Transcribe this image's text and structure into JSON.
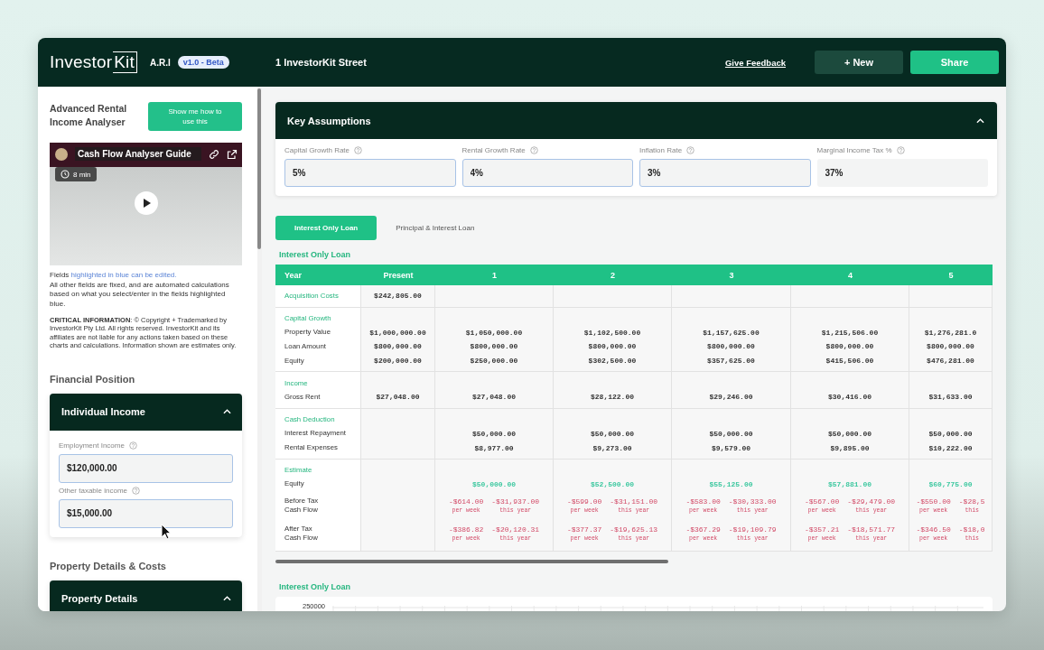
{
  "header": {
    "logo": {
      "word": "Investor",
      "boxed": "Kit"
    },
    "app_name": "A.R.I",
    "version_badge": "v1.0 - Beta",
    "property_address": "1 InvestorKit Street",
    "feedback_link": "Give Feedback",
    "buttons": [
      {
        "label": "+ New",
        "kind": "secondary"
      },
      {
        "label": "Share",
        "kind": "primary"
      }
    ]
  },
  "sidebar": {
    "title": "Advanced Rental Income Analyser",
    "help_button": "Show me how to use this",
    "video": {
      "title": "Cash Flow Analyser Guide",
      "duration": "8 min"
    },
    "fields_note": {
      "lead": "Fields",
      "highlight": "highlighted in blue can be edited.",
      "rest": "All other fields are fixed, and are automated calculations based on what you select/enter in the fields highlighted blue."
    },
    "critical_info": "**CRITICAL INFORMATION**: © Copyright + Trademarked by InvestorKit Pty Ltd. All rights reserved. InvestorKit and its affiliates are not liable for any actions taken based on these charts and calculations. Information shown are estimates only.",
    "sections": [
      {
        "heading": "Financial Position",
        "panel": {
          "title": "Individual Income",
          "expanded": true,
          "fields": [
            {
              "label": "Employment Income",
              "value": "$120,000.00",
              "editable": true
            },
            {
              "label": "Other taxable income",
              "value": "$15,000.00",
              "editable": true
            }
          ]
        }
      },
      {
        "heading": "Property Details & Costs",
        "panel": {
          "title": "Property Details",
          "expanded": true
        }
      }
    ]
  },
  "key_assumptions": {
    "title": "Key Assumptions",
    "expanded": true,
    "fields": [
      {
        "label": "Capital Growth Rate",
        "value": "5%",
        "editable": true
      },
      {
        "label": "Rental Growth Rate",
        "value": "4%",
        "editable": true
      },
      {
        "label": "Inflation Rate",
        "value": "3%",
        "editable": true
      },
      {
        "label": "Marginal Income Tax %",
        "value": "37%",
        "editable": false
      }
    ]
  },
  "loan_tabs": [
    {
      "label": "Interest Only Loan",
      "selected": true
    },
    {
      "label": "Principal & Interest Loan",
      "selected": false
    }
  ],
  "table": {
    "title": "Interest Only Loan",
    "columns": [
      "Year",
      "Present",
      "1",
      "2",
      "3",
      "4",
      "5"
    ],
    "sections": [
      {
        "title": "Acquisition Costs",
        "present": "$242,805.00"
      },
      {
        "title": "Capital Growth",
        "rows": [
          {
            "label": "Property Value",
            "kind": "money",
            "present": "$1,000,000.00",
            "values": [
              "$1,050,000.00",
              "$1,102,500.00",
              "$1,157,625.00",
              "$1,215,506.00",
              "$1,276,281.0"
            ]
          },
          {
            "label": "Loan Amount",
            "kind": "money",
            "present": "$800,000.00",
            "values": [
              "$800,000.00",
              "$800,000.00",
              "$800,000.00",
              "$800,000.00",
              "$800,000.00"
            ]
          },
          {
            "label": "Equity",
            "kind": "money",
            "present": "$200,000.00",
            "values": [
              "$250,000.00",
              "$302,500.00",
              "$357,625.00",
              "$415,506.00",
              "$476,281.00"
            ]
          }
        ]
      },
      {
        "title": "Income",
        "rows": [
          {
            "label": "Gross Rent",
            "kind": "money",
            "present": "$27,048.00",
            "values": [
              "$27,048.00",
              "$28,122.00",
              "$29,246.00",
              "$30,416.00",
              "$31,633.00"
            ]
          }
        ]
      },
      {
        "title": "Cash Deduction",
        "rows": [
          {
            "label": "Interest Repayment",
            "kind": "money",
            "values": [
              "$50,000.00",
              "$50,000.00",
              "$50,000.00",
              "$50,000.00",
              "$50,000.00"
            ]
          },
          {
            "label": "Rental Expenses",
            "kind": "money",
            "values": [
              "$8,977.00",
              "$9,273.00",
              "$9,579.00",
              "$9,895.00",
              "$10,222.00"
            ]
          }
        ]
      },
      {
        "title": "Estimate",
        "rows": [
          {
            "label": "Equity",
            "kind": "gain",
            "values": [
              "$50,000.00",
              "$52,500.00",
              "$55,125.00",
              "$57,881.00",
              "$60,775.00"
            ]
          },
          {
            "label": "Before Tax Cash Flow",
            "kind": "split",
            "values": [
              {
                "week": "-$614.00",
                "week_label": "per week",
                "year": "-$31,937.00",
                "year_label": "this year"
              },
              {
                "week": "-$599.00",
                "week_label": "per week",
                "year": "-$31,151.00",
                "year_label": "this year"
              },
              {
                "week": "-$583.00",
                "week_label": "per week",
                "year": "-$30,333.00",
                "year_label": "this year"
              },
              {
                "week": "-$567.00",
                "week_label": "per week",
                "year": "-$29,479.00",
                "year_label": "this year"
              },
              {
                "week": "-$550.00",
                "week_label": "per week",
                "year": "-$28,5",
                "year_label": "this"
              }
            ]
          },
          {
            "label": "After Tax Cash Flow",
            "kind": "split",
            "values": [
              {
                "week": "-$386.82",
                "week_label": "per week",
                "year": "-$20,120.31",
                "year_label": "this year"
              },
              {
                "week": "-$377.37",
                "week_label": "per week",
                "year": "-$19,625.13",
                "year_label": "this year"
              },
              {
                "week": "-$367.29",
                "week_label": "per week",
                "year": "-$19,109.79",
                "year_label": "this year"
              },
              {
                "week": "-$357.21",
                "week_label": "per week",
                "year": "-$18,571.77",
                "year_label": "this year"
              },
              {
                "week": "-$346.50",
                "week_label": "per week",
                "year": "-$18,0",
                "year_label": "this"
              }
            ]
          }
        ]
      }
    ]
  },
  "chart": {
    "title": "Interest Only Loan",
    "y_tick": "250000"
  }
}
